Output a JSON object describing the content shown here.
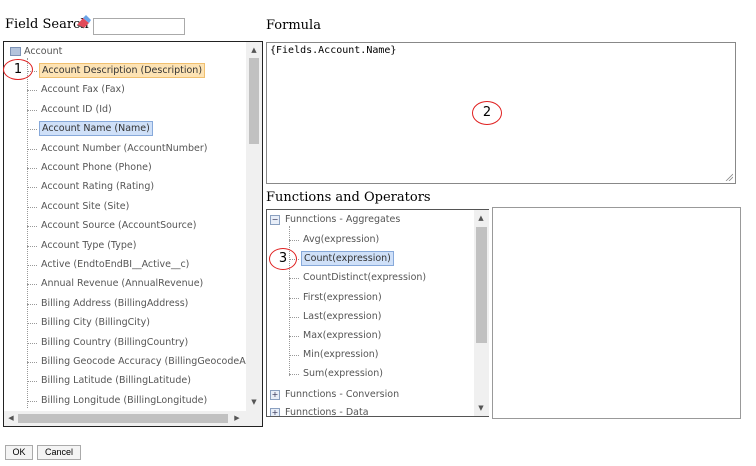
{
  "field_search": {
    "label": "Field Search",
    "value": ""
  },
  "field_tree": {
    "root": "Account",
    "items": [
      {
        "label": "Account Description (Description)",
        "state": "highlight"
      },
      {
        "label": "Account Fax (Fax)",
        "state": ""
      },
      {
        "label": "Account ID (Id)",
        "state": ""
      },
      {
        "label": "Account Name (Name)",
        "state": "selected"
      },
      {
        "label": "Account Number (AccountNumber)",
        "state": ""
      },
      {
        "label": "Account Phone (Phone)",
        "state": ""
      },
      {
        "label": "Account Rating (Rating)",
        "state": ""
      },
      {
        "label": "Account Site (Site)",
        "state": ""
      },
      {
        "label": "Account Source (AccountSource)",
        "state": ""
      },
      {
        "label": "Account Type (Type)",
        "state": ""
      },
      {
        "label": "Active (EndtoEndBI__Active__c)",
        "state": ""
      },
      {
        "label": "Annual Revenue (AnnualRevenue)",
        "state": ""
      },
      {
        "label": "Billing Address (BillingAddress)",
        "state": ""
      },
      {
        "label": "Billing City (BillingCity)",
        "state": ""
      },
      {
        "label": "Billing Country (BillingCountry)",
        "state": ""
      },
      {
        "label": "Billing Geocode Accuracy (BillingGeocodeAccuracy)",
        "state": ""
      },
      {
        "label": "Billing Latitude (BillingLatitude)",
        "state": ""
      },
      {
        "label": "Billing Longitude (BillingLongitude)",
        "state": ""
      }
    ]
  },
  "callouts": [
    "1",
    "2",
    "3"
  ],
  "formula": {
    "label": "Formula",
    "value": "{Fields.Account.Name}"
  },
  "functions": {
    "label": "Functions and Operators",
    "groups": [
      {
        "label": "Funnctions - Aggregates",
        "expanded": true
      },
      {
        "label": "Funnctions - Conversion",
        "expanded": false
      },
      {
        "label": "Funnctions - Data",
        "expanded": false
      }
    ],
    "aggregates": [
      {
        "label": "Avg(expression)",
        "state": ""
      },
      {
        "label": "Count(expression)",
        "state": "selected"
      },
      {
        "label": "CountDistinct(expression)",
        "state": ""
      },
      {
        "label": "First(expression)",
        "state": ""
      },
      {
        "label": "Last(expression)",
        "state": ""
      },
      {
        "label": "Max(expression)",
        "state": ""
      },
      {
        "label": "Min(expression)",
        "state": ""
      },
      {
        "label": "Sum(expression)",
        "state": ""
      }
    ],
    "description": ""
  },
  "buttons": {
    "ok": "OK",
    "cancel": "Cancel"
  }
}
